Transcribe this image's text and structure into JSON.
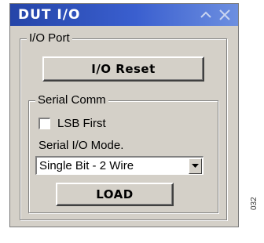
{
  "window": {
    "title": "DUT I/O",
    "minimize_icon": "caret-up-icon",
    "close_icon": "close-icon"
  },
  "io_port": {
    "label": "I/O Port",
    "reset_button": "I/O Reset"
  },
  "serial_comm": {
    "label": "Serial Comm",
    "lsb_first": {
      "label": "LSB First",
      "checked": false
    },
    "mode_label": "Serial I/O Mode.",
    "mode_value": "Single Bit - 2 Wire",
    "dropdown_icon": "chevron-down-icon",
    "load_button": "LOAD"
  },
  "figure_id": "032",
  "colors": {
    "titlebar": "#2545a8",
    "face": "#d4d0c8"
  }
}
